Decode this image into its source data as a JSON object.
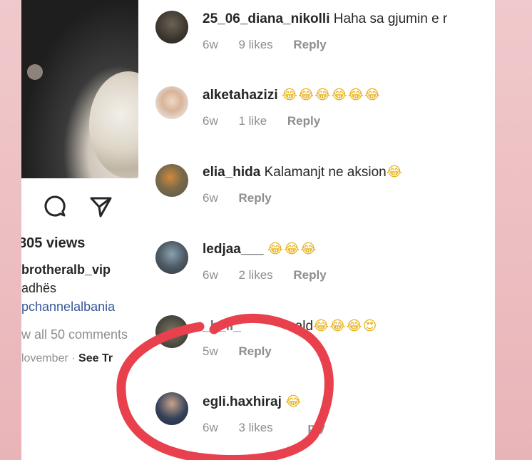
{
  "post": {
    "views": "805 views",
    "username": "brotheralb_vip",
    "caption": "adhës",
    "tag": "pchannelalbania",
    "view_all": "w all 50 comments",
    "date": "lovember",
    "separator": "·",
    "see_translation": "See Tr"
  },
  "comments": [
    {
      "user": "25_06_diana_nikolli",
      "text": "Haha sa gjumin e r",
      "emoji": "",
      "age": "6w",
      "likes": "9 likes",
      "reply": "Reply"
    },
    {
      "user": "alketahazizi",
      "text": "",
      "emoji": "😂😂😂😂😂😂",
      "age": "6w",
      "likes": "1 like",
      "reply": "Reply"
    },
    {
      "user": "elia_hida",
      "text": "Kalamanjt ne aksion",
      "emoji": "😂",
      "age": "6w",
      "likes": "",
      "reply": "Reply"
    },
    {
      "user": "ledjaa___",
      "text": "",
      "emoji": "😂😂😂",
      "age": "6w",
      "likes": "2 likes",
      "reply": "Reply"
    },
    {
      "user": "_b_li_",
      "text": "nald",
      "emoji": "😂😂😂😍",
      "age": "5w",
      "likes": "",
      "reply": "Reply"
    },
    {
      "user": "egli.haxhiraj",
      "text": "",
      "emoji": "😂",
      "age": "6w",
      "likes": "3 likes",
      "reply": "ply"
    }
  ],
  "colors": {
    "background": "#e9b4b8",
    "panel": "#ffffff",
    "text": "#262626",
    "meta": "#8e8e8e",
    "annotation": "#e8404c"
  },
  "icons": [
    "comment-icon",
    "share-icon"
  ]
}
